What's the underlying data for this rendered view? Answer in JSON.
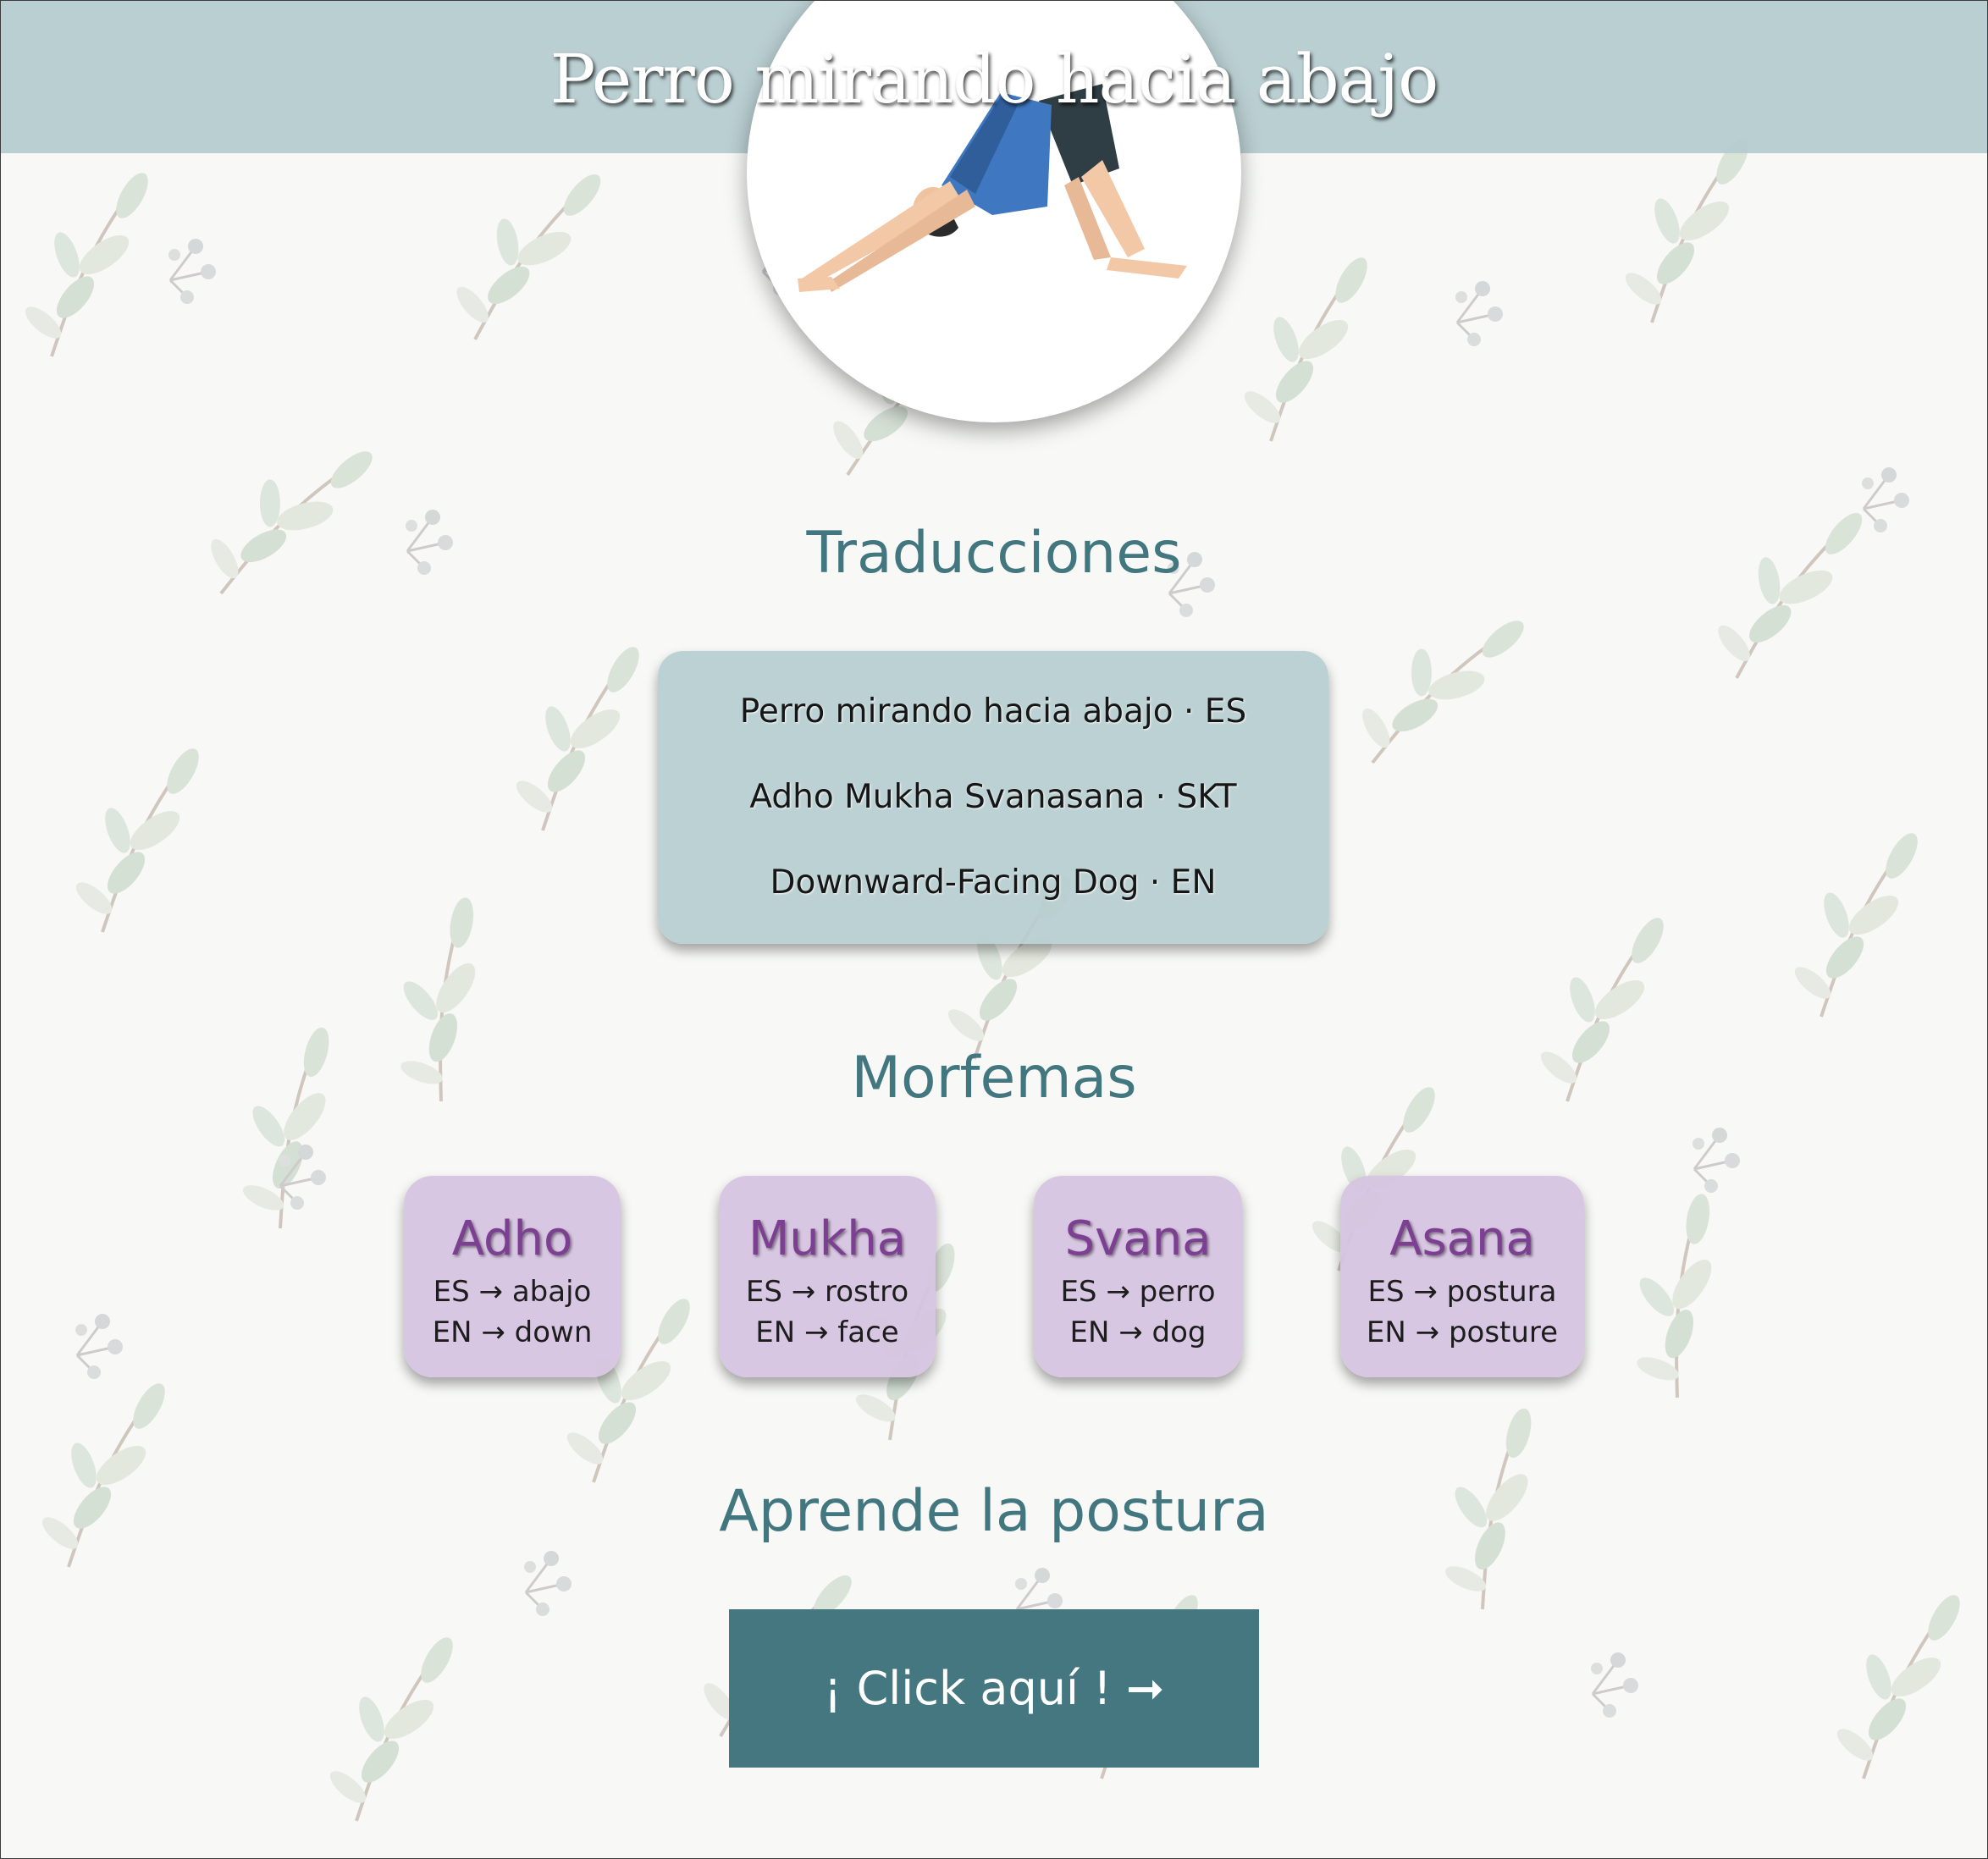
{
  "header": {
    "title": "Perro mirando hacia abajo",
    "band_color": "#b4cbce",
    "pose_image": "downward-dog-illustration"
  },
  "translations": {
    "heading": "Traducciones",
    "items": [
      {
        "text": "Perro mirando hacia abajo · ES"
      },
      {
        "text": "Adho Mukha Svanasana · SKT"
      },
      {
        "text": "Downward-Facing Dog · EN"
      }
    ]
  },
  "morphemes": {
    "heading": "Morfemas",
    "items": [
      {
        "title": "Adho",
        "es": "ES → abajo",
        "en": "EN → down"
      },
      {
        "title": "Mukha",
        "es": "ES → rostro",
        "en": "EN → face"
      },
      {
        "title": "Svana",
        "es": "ES → perro",
        "en": "EN → dog"
      },
      {
        "title": "Asana",
        "es": "ES → postura",
        "en": "EN → posture"
      }
    ]
  },
  "learn": {
    "heading": "Aprende la postura",
    "button_label": "¡ Click aquí ! ➞"
  },
  "colors": {
    "accent": "#44777f",
    "morpheme_bg": "#d6c4e0",
    "morpheme_title": "#7c3f92"
  }
}
